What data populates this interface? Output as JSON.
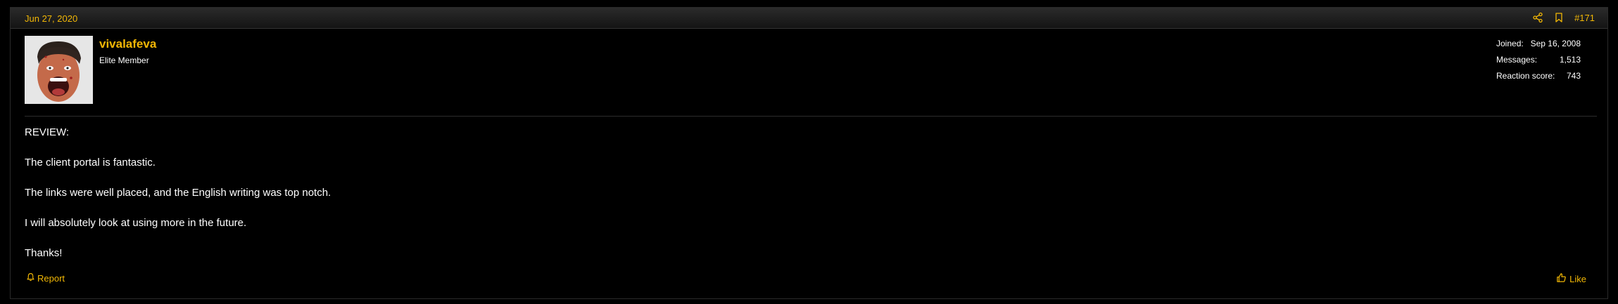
{
  "post": {
    "date": "Jun 27, 2020",
    "number": "#171",
    "author": {
      "username": "vivalafeva",
      "title": "Elite Member"
    },
    "stats": [
      {
        "label": "Joined:",
        "value": "Sep 16, 2008"
      },
      {
        "label": "Messages:",
        "value": "1,513"
      },
      {
        "label": "Reaction score:",
        "value": "743"
      }
    ],
    "paragraphs": [
      "REVIEW:",
      "The client portal is fantastic.",
      "The links were well placed, and the English writing was top notch.",
      "I will absolutely look at using more in the future.",
      "Thanks!"
    ],
    "actions": {
      "report_label": "Report",
      "like_label": "Like"
    },
    "icons": [
      "share-icon",
      "bookmark-icon",
      "bell-icon",
      "thumbs-up-icon"
    ],
    "colors": {
      "accent": "#f2b705",
      "background": "#000000",
      "text": "#ffffff"
    }
  }
}
